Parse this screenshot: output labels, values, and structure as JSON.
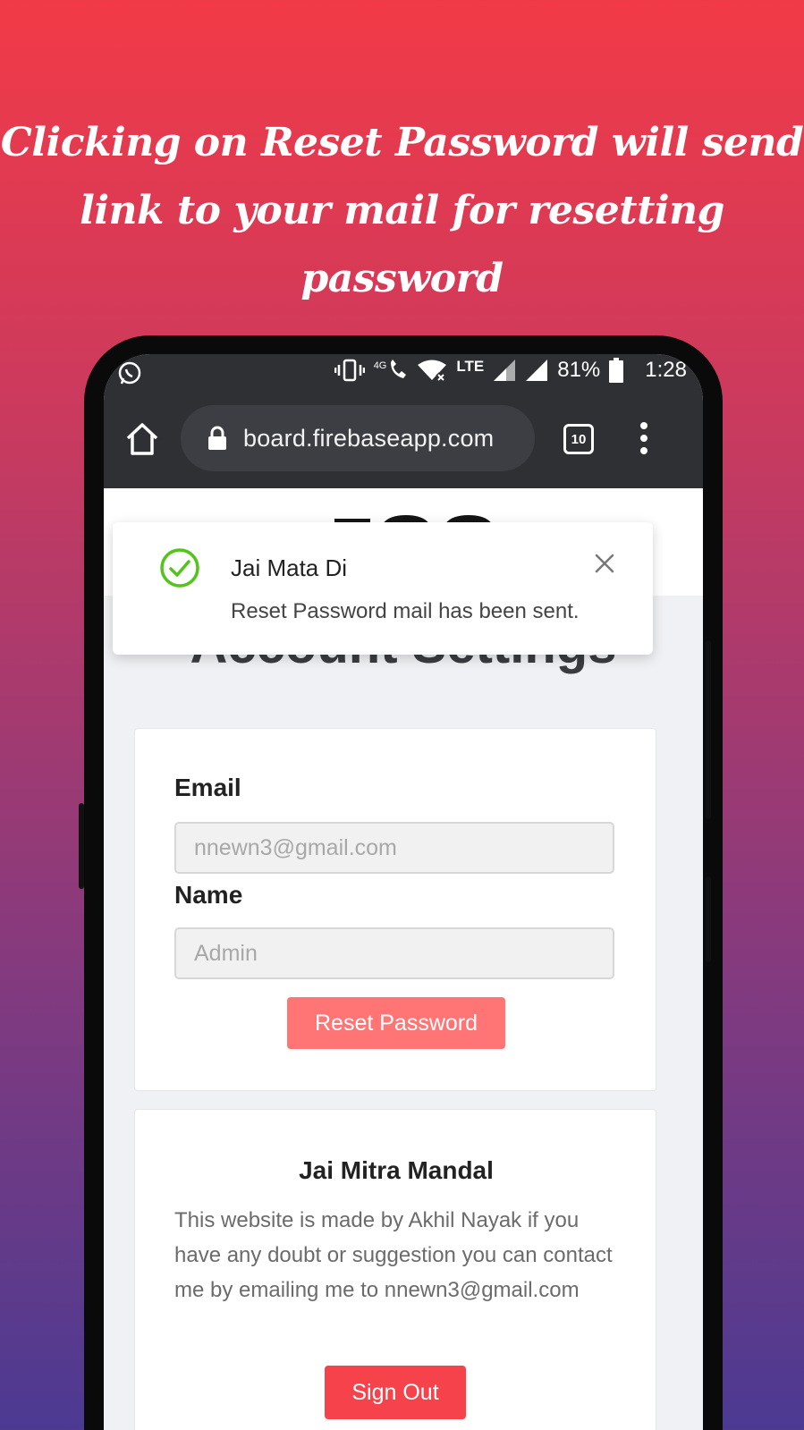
{
  "promo": {
    "line1": "Clicking on Reset Password will send",
    "line2": "link to your mail for resetting password"
  },
  "status_bar": {
    "battery": "81%",
    "time": "1:28",
    "network_label": "LTE",
    "network_4g": "4G",
    "icons": [
      "whatsapp-icon",
      "vibrate-icon",
      "wifi-calling-icon",
      "wifi-icon",
      "signal-icon",
      "battery-icon"
    ]
  },
  "browser": {
    "url": "board.firebaseapp.com",
    "tab_count": "10"
  },
  "page": {
    "title": "Account Settings"
  },
  "toast": {
    "title": "Jai Mata Di",
    "message": "Reset Password mail has been sent.",
    "accent": "#52c41a"
  },
  "account_form": {
    "email_label": "Email",
    "email_placeholder": "nnewn3@gmail.com",
    "name_label": "Name",
    "name_placeholder": "Admin",
    "reset_button": "Reset Password",
    "reset_color": "#ff7474"
  },
  "footer_card": {
    "title": "Jai Mitra Mandal",
    "text": "This website is made by Akhil Nayak if you have any doubt or suggestion you can contact me by emailing me to nnewn3@gmail.com",
    "sign_out_button": "Sign Out",
    "sign_out_color": "#f5424b"
  }
}
